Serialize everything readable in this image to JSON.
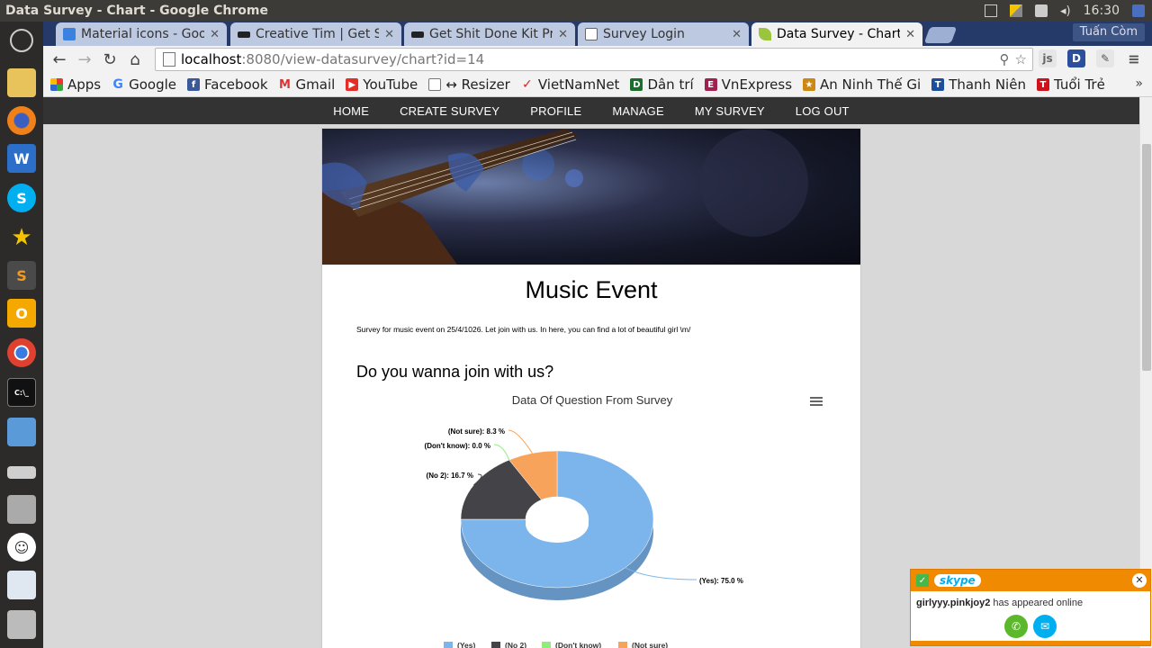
{
  "os": {
    "window_title": "Data Survey - Chart - Google Chrome",
    "clock": "16:30"
  },
  "launcher": {
    "items": [
      "ubuntu-dash",
      "files",
      "firefox",
      "writer",
      "skype",
      "favorites",
      "sublime",
      "mail",
      "chrome",
      "terminal",
      "display",
      "drive",
      "archive",
      "smiley",
      "workbench",
      "printer"
    ]
  },
  "browser": {
    "tabs": [
      {
        "label": "Material icons - Goog",
        "active": false
      },
      {
        "label": "Creative Tim | Get Sh",
        "active": false
      },
      {
        "label": "Get Shit Done Kit Pro",
        "active": false
      },
      {
        "label": "Survey Login",
        "active": false
      },
      {
        "label": "Data Survey - Chart",
        "active": true
      }
    ],
    "user": "Tuấn Còm",
    "url_host": "localhost",
    "url_path": ":8080/view-datasurvey/chart?id=14",
    "bookmarks": [
      "Apps",
      "Google",
      "Facebook",
      "Gmail",
      "YouTube",
      "↔ Resizer",
      "VietNamNet",
      "Dân trí",
      "VnExpress",
      "An Ninh Thế Gi",
      "Thanh Niên",
      "Tuổi Trẻ"
    ]
  },
  "site": {
    "nav": [
      "HOME",
      "CREATE SURVEY",
      "PROFILE",
      "MANAGE",
      "MY SURVEY",
      "LOG OUT"
    ],
    "title": "Music Event",
    "description": "Survey for music event on 25/4/1026. Let join with us. In here, you can find a lot of beautiful girl \\m/",
    "question": "Do you wanna join with us?"
  },
  "chart_data": {
    "type": "pie",
    "title": "Data Of Question From Survey",
    "categories": [
      "(Yes)",
      "(No 2)",
      "(Don't know)",
      "(Not sure)"
    ],
    "values": [
      75.0,
      16.7,
      0.0,
      8.3
    ],
    "data_labels": [
      "(Yes): 75.0 %",
      "(No 2): 16.7 %",
      "(Don't know): 0.0 %",
      "(Not sure): 8.3 %"
    ],
    "colors": [
      "#7cb5ec",
      "#434348",
      "#90ed7d",
      "#f7a35c"
    ],
    "legend_position": "bottom",
    "donut": true
  },
  "toast": {
    "app": "skype",
    "user": "girlyyy.pinkjoy2",
    "message": " has appeared online"
  }
}
